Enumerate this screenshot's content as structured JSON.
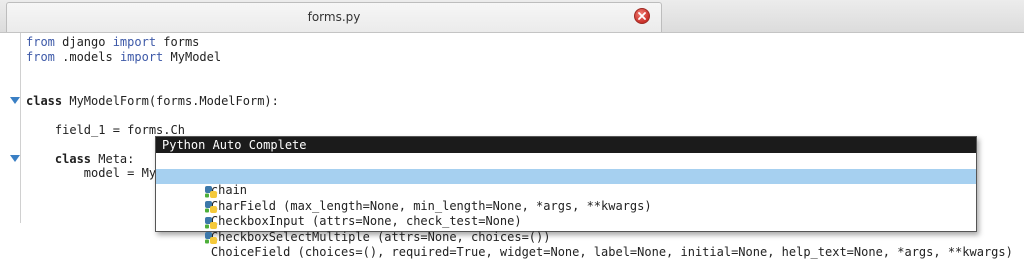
{
  "tab": {
    "title": "forms.py",
    "close_icon": "close-icon"
  },
  "code": {
    "line1": {
      "kw1": "from",
      "mod": " django ",
      "kw2": "import",
      "rest": " forms"
    },
    "line2": {
      "kw1": "from",
      "mod": " .models ",
      "kw2": "import",
      "rest": " MyModel"
    },
    "line4": {
      "kw": "class",
      "rest": " MyModelForm(forms.ModelForm):"
    },
    "line6": "    field_1 = forms.Ch",
    "line8": {
      "indent": "    ",
      "kw": "class",
      "rest": " Meta:"
    },
    "line9": "        model = MyM"
  },
  "autocomplete": {
    "title": "Python Auto Complete",
    "items": [
      {
        "label": "chain",
        "icon": "document-icon"
      },
      {
        "label": "CharField (max_length=None, min_length=None, *args, **kwargs)",
        "icon": "python-class-icon",
        "selected": true
      },
      {
        "label": "CheckboxInput (attrs=None, check_test=None)",
        "icon": "python-class-icon"
      },
      {
        "label": "CheckboxSelectMultiple (attrs=None, choices=())",
        "icon": "python-class-icon"
      },
      {
        "label": "ChoiceField (choices=(), required=True, widget=None, label=None, initial=None, help_text=None, *args, **kwargs)",
        "icon": "python-class-icon"
      }
    ]
  },
  "colors": {
    "selection": "#a6d0f0",
    "keyword": "#3d59a8",
    "fold_arrow": "#3a7fc4",
    "close_button": "#c9302a"
  }
}
